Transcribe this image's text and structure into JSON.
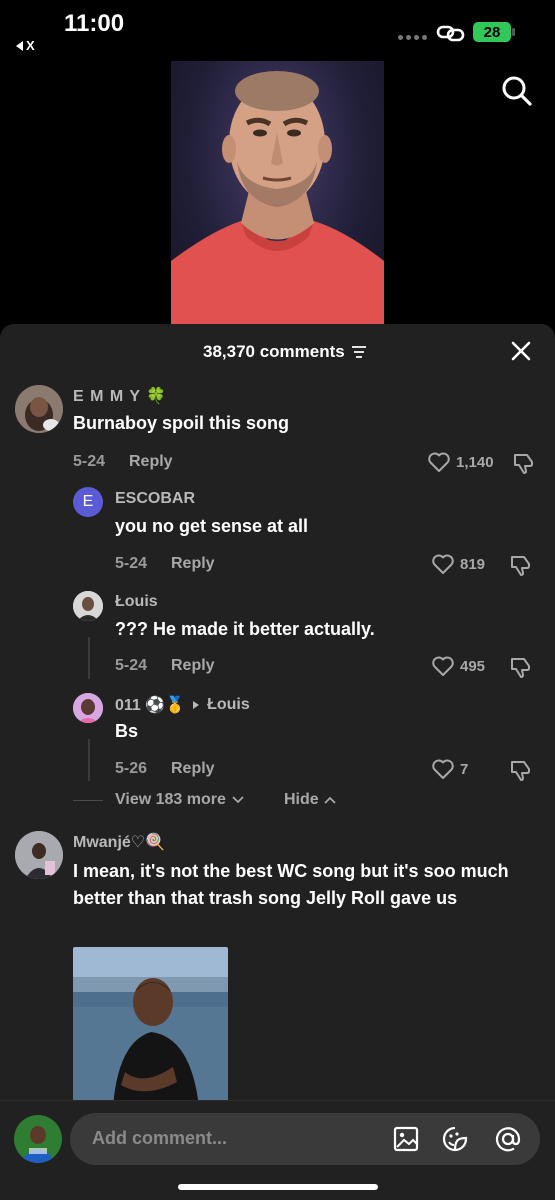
{
  "status": {
    "time": "11:00",
    "back_label": "X",
    "battery": "28"
  },
  "sheet": {
    "count_label": "38,370 comments"
  },
  "comments": [
    {
      "name": "E M M Y 🍀",
      "text": "Burnaboy spoil this song",
      "date": "5-24",
      "reply": "Reply",
      "likes": "1,140"
    },
    {
      "name": "ESCOBAR",
      "avatar_letter": "E",
      "text": "you no get sense at all",
      "date": "5-24",
      "reply": "Reply",
      "likes": "819"
    },
    {
      "name": "Łouis",
      "text": "??? He made it better actually.",
      "date": "5-24",
      "reply": "Reply",
      "likes": "495"
    },
    {
      "name": "011 ⚽🥇",
      "reply_to": "Łouis",
      "text": "Bs",
      "date": "5-26",
      "reply": "Reply",
      "likes": "7"
    },
    {
      "name": "Mwanjé♡🍭",
      "text": "I mean, it's not the best WC song but it's soo much better than that trash song Jelly Roll gave us"
    }
  ],
  "thread": {
    "view_more": "View 183 more",
    "hide": "Hide"
  },
  "input": {
    "placeholder": "Add comment..."
  },
  "colors": {
    "sheet_bg": "#212121",
    "battery": "#32c759",
    "escobar_avatar": "#5b5bd6"
  }
}
